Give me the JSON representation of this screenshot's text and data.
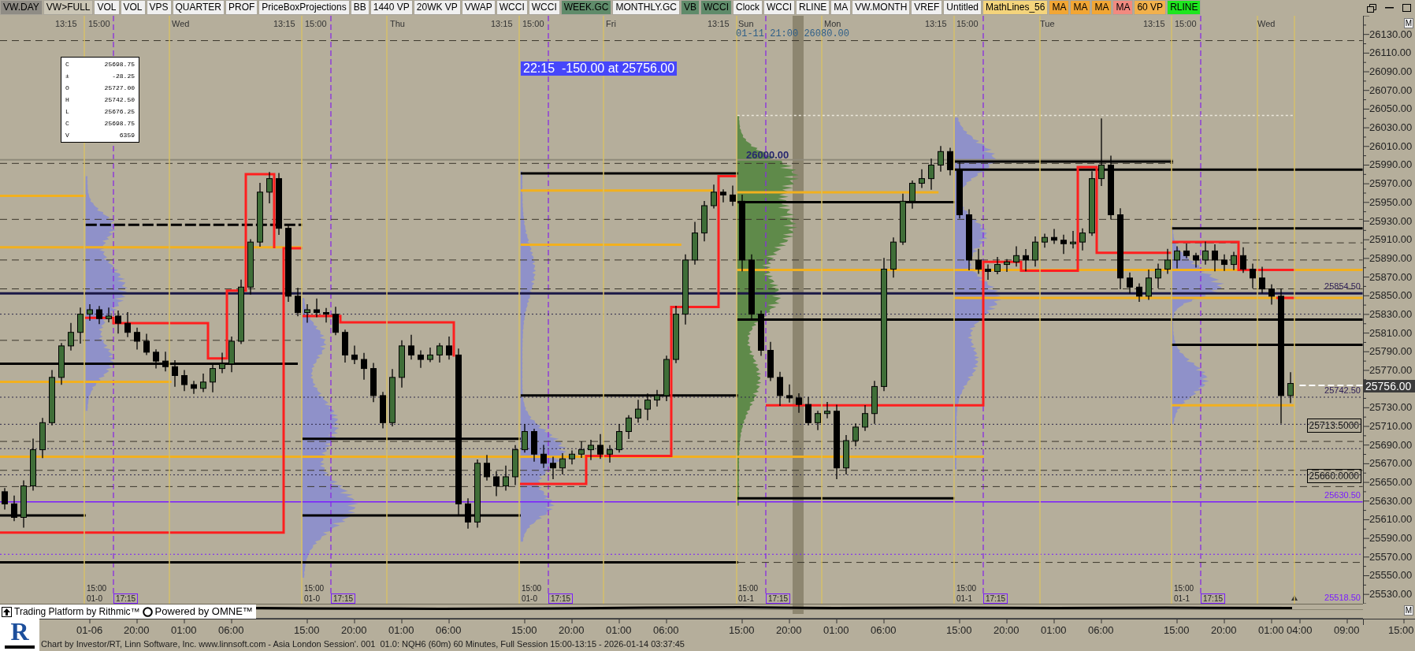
{
  "toolbar": [
    {
      "label": "VW.DAY",
      "color": "#8f8c85"
    },
    {
      "label": "VW>FULL",
      "color": "#cbc6b6"
    },
    {
      "label": "VOL",
      "color": "#f0f0f0"
    },
    {
      "label": "VOL",
      "color": "#f0f0f0"
    },
    {
      "label": "VPS",
      "color": "#f0f0f0"
    },
    {
      "label": "QUARTER",
      "color": "#f0f0f0"
    },
    {
      "label": "PROF",
      "color": "#f0f0f0"
    },
    {
      "label": "PriceBoxProjections",
      "color": "#f0f0f0"
    },
    {
      "label": "BB",
      "color": "#f0f0f0"
    },
    {
      "label": "1440 VP",
      "color": "#f0f0f0"
    },
    {
      "label": "20WK VP",
      "color": "#f0f0f0"
    },
    {
      "label": "VWAP",
      "color": "#f0f0f0"
    },
    {
      "label": "WCCI",
      "color": "#f0f0f0"
    },
    {
      "label": "WCCI",
      "color": "#f0f0f0"
    },
    {
      "label": "WEEK.GC",
      "color": "#5f8b6a"
    },
    {
      "label": "MONTHLY.GC",
      "color": "#f0f0f0"
    },
    {
      "label": "VB",
      "color": "#5f8b6a"
    },
    {
      "label": "WCCI",
      "color": "#5f8b6a"
    },
    {
      "label": "Clock",
      "color": "#f0f0f0"
    },
    {
      "label": "WCCI",
      "color": "#f0f0f0"
    },
    {
      "label": "RLINE",
      "color": "#f0f0f0"
    },
    {
      "label": "MA",
      "color": "#f0f0f0"
    },
    {
      "label": "VW.MONTH",
      "color": "#f0f0f0"
    },
    {
      "label": "VREF",
      "color": "#f0f0f0"
    },
    {
      "label": "Untitled",
      "color": "#f0f0f0"
    },
    {
      "label": "MathLines_56",
      "color": "#f4d47c"
    },
    {
      "label": "MA",
      "color": "#f2a634"
    },
    {
      "label": "MA",
      "color": "#f2a634"
    },
    {
      "label": "MA",
      "color": "#f2a634"
    },
    {
      "label": "MA",
      "color": "#f28a80"
    },
    {
      "label": "60 VP",
      "color": "#f2b14c"
    },
    {
      "label": "RLINE",
      "color": "#1ee61e"
    }
  ],
  "chart": {
    "chart_data": {
      "type": "candlestick",
      "categories": [
        null,
        null,
        null,
        null,
        null,
        null,
        null,
        null,
        null,
        "01-06",
        null,
        null,
        null,
        null,
        "20:00",
        null,
        null,
        null,
        null,
        "01:00",
        null,
        null,
        null,
        null,
        "06:00",
        null,
        null,
        null,
        null,
        null,
        null,
        null,
        "15:00",
        null,
        null,
        null,
        null,
        "20:00",
        null,
        null,
        null,
        null,
        "01:00",
        null,
        null,
        null,
        null,
        "06:00",
        null,
        null,
        null,
        null,
        null,
        null,
        null,
        "15:00",
        null,
        null,
        null,
        null,
        "20:00",
        null,
        null,
        null,
        null,
        "01:00",
        null,
        null,
        null,
        null,
        "06:00",
        null,
        null,
        null,
        null,
        null,
        null,
        null,
        "15:00",
        null,
        null,
        null,
        null,
        "20:00",
        null,
        null,
        null,
        null,
        "01:00",
        null,
        null,
        null,
        null,
        "06:00",
        null,
        null,
        null,
        null,
        null,
        null,
        null,
        "15:00",
        null,
        null,
        null,
        null,
        "20:00",
        null,
        null,
        null,
        null,
        "01:00",
        null,
        null,
        null,
        null,
        "06:00",
        null,
        null,
        null,
        null,
        null,
        null,
        null,
        "15:00",
        null,
        null,
        null,
        null,
        "20:00",
        null,
        null,
        null,
        null,
        "01:00",
        null,
        null,
        "04:00",
        null,
        null,
        null,
        null,
        "09:00",
        null,
        null,
        null,
        null,
        null,
        "15:00"
      ],
      "ohlc": [
        [
          25640,
          25644,
          25621,
          25627
        ],
        [
          25627,
          25636,
          25608.5,
          25612.5
        ],
        [
          25612.5,
          25652.25,
          25601.5,
          25646.25
        ],
        [
          25646.25,
          25697,
          25641.25,
          25685
        ],
        [
          25685,
          25719,
          25676,
          25714
        ],
        [
          25714,
          25770.5,
          25711,
          25762.5
        ],
        [
          25762.5,
          25799.25,
          25754.5,
          25796.25
        ],
        [
          25796.25,
          25820.75,
          25791.25,
          25810.75
        ],
        [
          25810.75,
          25837.25,
          25798.75,
          25830.25
        ],
        [
          25830.25,
          25841,
          25823.25,
          25835
        ],
        [
          25835,
          25839,
          25819.5,
          25825.5
        ],
        [
          25825.5,
          25837.25,
          25821.5,
          25828.25
        ],
        [
          25828.25,
          25834.25,
          25809.5,
          25820.5
        ],
        [
          25820.5,
          25832.5,
          25805.75,
          25810.75
        ],
        [
          25810.75,
          25815.75,
          25792.25,
          25801.25
        ],
        [
          25801.25,
          25809.25,
          25786.5,
          25789.5
        ],
        [
          25789.5,
          25792.5,
          25772,
          25780
        ],
        [
          25780,
          25790,
          25769,
          25774
        ],
        [
          25774,
          25781,
          25752.5,
          25764.5
        ],
        [
          25764.5,
          25770.5,
          25747.75,
          25754.75
        ],
        [
          25754.75,
          25758.75,
          25744.75,
          25750.75
        ],
        [
          25750.75,
          25766.5,
          25746.75,
          25757.5
        ],
        [
          25757.5,
          25778,
          25746.5,
          25772
        ],
        [
          25772,
          25789,
          25767,
          25777
        ],
        [
          25777,
          25806.25,
          25768,
          25801.25
        ],
        [
          25801.25,
          25867.25,
          25798.25,
          25859.25
        ],
        [
          25859.25,
          25910.5,
          25851.25,
          25907.5
        ],
        [
          25907.5,
          25971,
          25902.5,
          25961
        ],
        [
          25961,
          25982.5,
          25949,
          25975.5
        ],
        [
          25975.5,
          25981.5,
          25915.25,
          25922.25
        ],
        [
          25922.25,
          25926.25,
          25843.5,
          25849.5
        ],
        [
          25849.5,
          25858.5,
          25828,
          25832
        ],
        [
          25832,
          25841,
          25821,
          25835
        ],
        [
          25835,
          25847,
          25827,
          25832
        ],
        [
          25832,
          25837,
          25821.25,
          25830.25
        ],
        [
          25830.25,
          25838.25,
          25807.75,
          25810.75
        ],
        [
          25810.75,
          25813.75,
          25778.5,
          25786.5
        ],
        [
          25786.5,
          25796.5,
          25776.75,
          25781.75
        ],
        [
          25781.75,
          25788.75,
          25760,
          25772
        ],
        [
          25772,
          25778,
          25736,
          25743
        ],
        [
          25743,
          25747,
          25708,
          25714
        ],
        [
          25714,
          25771.5,
          25710,
          25762.5
        ],
        [
          25762.5,
          25802.25,
          25751.5,
          25796.25
        ],
        [
          25796.25,
          25808.25,
          25781.5,
          25786.5
        ],
        [
          25786.5,
          25791.5,
          25772.75,
          25781.75
        ],
        [
          25781.75,
          25794.5,
          25778.75,
          25786.5
        ],
        [
          25786.5,
          25799.25,
          25778.5,
          25796.25
        ],
        [
          25796.25,
          25806.25,
          25781.5,
          25786.5
        ],
        [
          25786.5,
          25793.5,
          25615,
          25627
        ],
        [
          25627,
          25633,
          25600.5,
          25607.5
        ],
        [
          25607.5,
          25674.5,
          25601.5,
          25670.5
        ],
        [
          25670.5,
          25679.5,
          25652,
          25656
        ],
        [
          25656,
          25662,
          25635.25,
          25646.25
        ],
        [
          25646.25,
          25668,
          25641.25,
          25656
        ],
        [
          25656,
          25690,
          25647,
          25685
        ],
        [
          25685,
          25712.5,
          25682,
          25704.5
        ],
        [
          25704.5,
          25707.5,
          25672.25,
          25680.25
        ],
        [
          25680.25,
          25690.25,
          25665.5,
          25670.5
        ],
        [
          25670.5,
          25677.5,
          25653.5,
          25665.5
        ],
        [
          25665.5,
          25681.25,
          25658.5,
          25675.25
        ],
        [
          25675.25,
          25684.25,
          25669.25,
          25680.25
        ],
        [
          25680.25,
          25694,
          25676.25,
          25685
        ],
        [
          25685,
          25695.75,
          25674,
          25689.75
        ],
        [
          25689.75,
          25701.75,
          25675.25,
          25680.25
        ],
        [
          25680.25,
          25690,
          25671.25,
          25685
        ],
        [
          25685,
          25712.5,
          25682,
          25704.5
        ],
        [
          25704.5,
          25722,
          25696.5,
          25719
        ],
        [
          25719,
          25738.5,
          25714,
          25728.5
        ],
        [
          25728.5,
          25745.25,
          25716.5,
          25738.25
        ],
        [
          25738.25,
          25749,
          25731.25,
          25743
        ],
        [
          25743,
          25785.75,
          25737,
          25781.75
        ],
        [
          25781.75,
          25839.25,
          25777.75,
          25830.25
        ],
        [
          25830.25,
          25894.25,
          25819.25,
          25888.25
        ],
        [
          25888.25,
          25929.25,
          25883.25,
          25917.25
        ],
        [
          25917.25,
          25951.5,
          25908.25,
          25946.5
        ],
        [
          25946.5,
          25969,
          25943.5,
          25961
        ],
        [
          25961,
          25964,
          25950,
          25958
        ],
        [
          25958,
          25968,
          25946.25,
          25951.25
        ],
        [
          25951.25,
          25958.25,
          25876.25,
          25888.25
        ],
        [
          25888.25,
          25894.25,
          25823.25,
          25830.25
        ],
        [
          25830.25,
          25834.25,
          25785.5,
          25791.5
        ],
        [
          25791.5,
          25800.5,
          25758.5,
          25762.5
        ],
        [
          25762.5,
          25768.5,
          25732,
          25743
        ],
        [
          25743,
          25755,
          25735.5,
          25740.5
        ],
        [
          25740.5,
          25745.5,
          25724.5,
          25733.5
        ],
        [
          25733.5,
          25741.5,
          25711,
          25714
        ],
        [
          25714,
          25726.75,
          25706,
          25723.75
        ],
        [
          25723.75,
          25736.25,
          25718.75,
          25726.25
        ],
        [
          25726.25,
          25733.25,
          25653.5,
          25665.5
        ],
        [
          25665.5,
          25700.75,
          25658.5,
          25694.75
        ],
        [
          25694.75,
          25713.25,
          25688.75,
          25709.25
        ],
        [
          25709.25,
          25732.75,
          25705.25,
          25723.75
        ],
        [
          25723.75,
          25758.75,
          25712.75,
          25752.75
        ],
        [
          25752.75,
          25890.5,
          25747.75,
          25878.5
        ],
        [
          25878.5,
          25912.5,
          25869.5,
          25907.5
        ],
        [
          25907.5,
          25959.25,
          25904.5,
          25951.25
        ],
        [
          25951.25,
          25973.5,
          25943.25,
          25970.5
        ],
        [
          25970.5,
          25985.5,
          25965.5,
          25975.5
        ],
        [
          25975.5,
          25997,
          25963.5,
          25990
        ],
        [
          25990,
          26010.5,
          25983,
          26004.5
        ],
        [
          26004.5,
          26008.5,
          25979,
          25985
        ],
        [
          25985,
          25994,
          25932.75,
          25936.75
        ],
        [
          25936.75,
          25942.75,
          25877.25,
          25888.25
        ],
        [
          25888.25,
          25900.25,
          25873.5,
          25878.5
        ],
        [
          25878.5,
          25883.5,
          25867,
          25876
        ],
        [
          25876,
          25891.5,
          25873,
          25883.5
        ],
        [
          25883.5,
          25889.25,
          25875.5,
          25886.25
        ],
        [
          25886.25,
          25903,
          25881.25,
          25893
        ],
        [
          25893,
          25900,
          25876.25,
          25888.25
        ],
        [
          25888.25,
          25913.5,
          25881.25,
          25907.5
        ],
        [
          25907.5,
          25916.5,
          25901.5,
          25912.5
        ],
        [
          25912.5,
          25921.5,
          25905.5,
          25909.5
        ],
        [
          25909.5,
          25915.5,
          25894.75,
          25905.75
        ],
        [
          25905.75,
          25919.5,
          25900.75,
          25907.5
        ],
        [
          25907.5,
          25922.25,
          25898.5,
          25917.25
        ],
        [
          25917.25,
          25983.5,
          25914.25,
          25975.5
        ],
        [
          25975.5,
          26040,
          25967.5,
          25990
        ],
        [
          25990,
          26000,
          25931.75,
          25936.75
        ],
        [
          25936.75,
          25943.75,
          25857,
          25869
        ],
        [
          25869,
          25875,
          25852.25,
          25859.25
        ],
        [
          25859.25,
          25863.25,
          25843.5,
          25849.5
        ],
        [
          25849.5,
          25878,
          25845.5,
          25869
        ],
        [
          25869,
          25884.5,
          25858,
          25878.5
        ],
        [
          25878.5,
          25900.25,
          25873.5,
          25888.25
        ],
        [
          25888.25,
          25903,
          25879.25,
          25898
        ],
        [
          25898,
          25906,
          25890,
          25893
        ],
        [
          25893,
          25896,
          25880.25,
          25888.25
        ],
        [
          25888.25,
          25908,
          25883.25,
          25898
        ],
        [
          25898,
          25905,
          25876.25,
          25888.25
        ],
        [
          25888.25,
          25894.25,
          25876.5,
          25883.5
        ],
        [
          25883.5,
          25897,
          25877.5,
          25893
        ],
        [
          25893,
          25902,
          25874.5,
          25878.5
        ],
        [
          25878.5,
          25884.5,
          25858,
          25869
        ],
        [
          25869,
          25881,
          25852.25,
          25857.25
        ],
        [
          25857.25,
          25862.25,
          25840.5,
          25849.5
        ],
        [
          25849.5,
          25857.5,
          25713,
          25743
        ],
        [
          25743,
          25768,
          25735,
          25756
        ],
        null,
        null,
        null,
        null,
        null,
        null,
        null,
        null,
        null,
        null,
        null,
        null
      ],
      "ylim": [
        25520,
        26150
      ],
      "grid": true,
      "yticks": [
        {
          "value": 26130,
          "label": "26130.00"
        },
        {
          "value": 26110,
          "label": "26110.00"
        },
        {
          "value": 26090,
          "label": "26090.00"
        },
        {
          "value": 26070,
          "label": "26070.00"
        },
        {
          "value": 26050,
          "label": "26050.00"
        },
        {
          "value": 26030,
          "label": "26030.00"
        },
        {
          "value": 26010,
          "label": "26010.00"
        },
        {
          "value": 25990,
          "label": "25990.00"
        },
        {
          "value": 25970,
          "label": "25970.00"
        },
        {
          "value": 25950,
          "label": "25950.00"
        },
        {
          "value": 25930,
          "label": "25930.00"
        },
        {
          "value": 25910,
          "label": "25910.00"
        },
        {
          "value": 25890,
          "label": "25890.00"
        },
        {
          "value": 25870,
          "label": "25870.00"
        },
        {
          "value": 25850,
          "label": "25850.00"
        },
        {
          "value": 25830,
          "label": "25830.00"
        },
        {
          "value": 25810,
          "label": "25810.00"
        },
        {
          "value": 25790,
          "label": "25790.00"
        },
        {
          "value": 25770,
          "label": "25770.00"
        },
        {
          "value": 25730,
          "label": "25730.00"
        },
        {
          "value": 25710,
          "label": "25710.00"
        },
        {
          "value": 25690,
          "label": "25690.00"
        },
        {
          "value": 25670,
          "label": "25670.00"
        },
        {
          "value": 25650,
          "label": "25650.00"
        },
        {
          "value": 25630,
          "label": "25630.00"
        },
        {
          "value": 25610,
          "label": "25610.00"
        },
        {
          "value": 25590,
          "label": "25590.00"
        },
        {
          "value": 25570,
          "label": "25570.00"
        },
        {
          "value": 25550,
          "label": "25550.00"
        },
        {
          "value": 25530,
          "label": "25530.00"
        }
      ],
      "annotations": [
        "25756.00"
      ]
    },
    "top_time_labels": [
      "13:15",
      "15:00",
      "Wed",
      "13:15",
      "15:00",
      "Thu",
      "13:15",
      "15:00",
      "Fri",
      "13:15",
      "Sun",
      "Mon",
      "13:15",
      "15:00",
      "Tue",
      "13:15",
      "15:00",
      "Wed"
    ],
    "ohlc_legend": [
      {
        "key": "C",
        "value": "25698.75"
      },
      {
        "key": "±",
        "value": "-28.25"
      },
      {
        "key": "O",
        "value": "25727.00"
      },
      {
        "key": "H",
        "value": "25742.50"
      },
      {
        "key": "L",
        "value": "25676.25"
      },
      {
        "key": "C",
        "value": "25698.75"
      },
      {
        "key": "V",
        "value": "6359"
      }
    ],
    "change_label": "22:15  -150.00 at 25756.00",
    "annotations": [
      "01-11 21:00 26080.00",
      "26000.00"
    ],
    "level_labels": [
      {
        "text": "25854.50",
        "kind": "plain",
        "color": "#2b1c55"
      },
      {
        "text": "25742.50",
        "kind": "plain",
        "color": "#2b1c55"
      },
      {
        "text": "25713.5000",
        "kind": "boxed",
        "color": "#1a1a1a"
      },
      {
        "text": "25660.0000",
        "kind": "boxed",
        "color": "#1a1a1a"
      },
      {
        "text": "25630.50",
        "kind": "plain",
        "color": "#7a1cff"
      },
      {
        "text": "25518.50",
        "kind": "plain",
        "color": "#7a1cff"
      }
    ],
    "session_labels": [
      {
        "time": "15:00",
        "date": "01-0",
        "close": "17:15"
      },
      {
        "time": "15:00",
        "date": "01-0",
        "close": "17:15"
      },
      {
        "time": "15:00",
        "date": "01-0",
        "close": "17:15"
      },
      {
        "time": "15:00",
        "date": "01-1",
        "close": "17:15"
      },
      {
        "time": "15:00",
        "date": "01-1",
        "close": "17:15"
      },
      {
        "time": "15:00",
        "date": "01-1",
        "close": "17:15"
      }
    ]
  },
  "price_axis": {
    "buttons": [
      "M",
      "M"
    ]
  },
  "overview": {
    "banner": "Trading Platform by Rithmic™",
    "powered_by": "Powered by OMNE™"
  },
  "footer": {
    "logo": "R",
    "status": "Chart by Investor/RT, Linn Software, Inc. www.linnsoft.com - Asia London Session'. 001  01.0: NQH6 (60m) 60 Minutes, Full Session 15:00-13:15 - 2026-01-14 03:37:45"
  }
}
